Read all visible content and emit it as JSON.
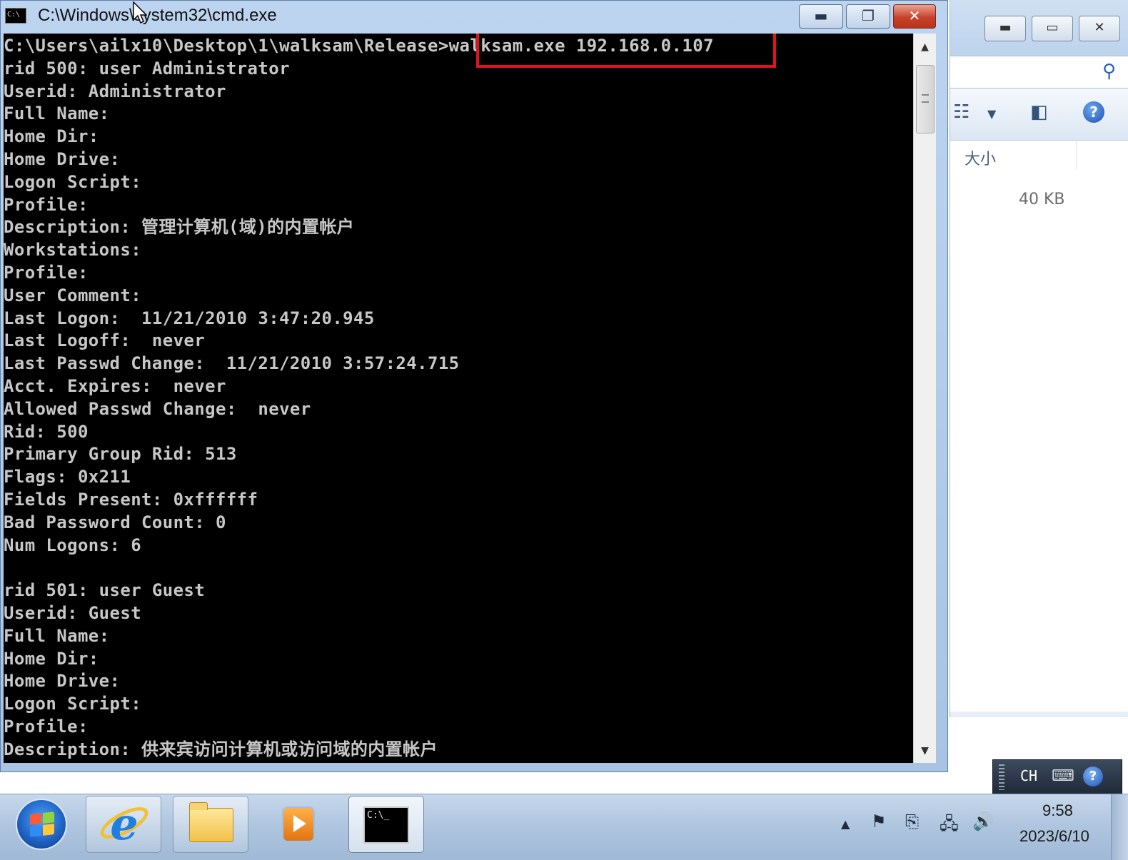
{
  "explorer": {
    "column_header": "大小",
    "file_size": "40 KB"
  },
  "cmd": {
    "title": "C:\\Windows\\system32\\cmd.exe",
    "icon_text": "C:\\",
    "lines": [
      "C:\\Users\\ailx10\\Desktop\\1\\walksam\\Release>walksam.exe 192.168.0.107",
      "rid 500: user Administrator",
      "Userid: Administrator",
      "Full Name:",
      "Home Dir:",
      "Home Drive:",
      "Logon Script:",
      "Profile:",
      "Description: 管理计算机(域)的内置帐户",
      "Workstations:",
      "Profile:",
      "User Comment:",
      "Last Logon:  11/21/2010 3:47:20.945",
      "Last Logoff:  never",
      "Last Passwd Change:  11/21/2010 3:57:24.715",
      "Acct. Expires:  never",
      "Allowed Passwd Change:  never",
      "Rid: 500",
      "Primary Group Rid: 513",
      "Flags: 0x211",
      "Fields Present: 0xffffff",
      "Bad Password Count: 0",
      "Num Logons: 6",
      "",
      "rid 501: user Guest",
      "Userid: Guest",
      "Full Name:",
      "Home Dir:",
      "Home Drive:",
      "Logon Script:",
      "Profile:",
      "Description: 供来宾访问计算机或访问域的内置帐户"
    ]
  },
  "langbar": {
    "language": "CH"
  },
  "taskbar": {
    "cmd_icon_text": "C:\\_",
    "clock_time": "9:58",
    "clock_date": "2023/6/10"
  },
  "colors": {
    "console_bg": "#000000",
    "console_fg": "#c7c7c7",
    "highlight_box": "#e0141c"
  }
}
